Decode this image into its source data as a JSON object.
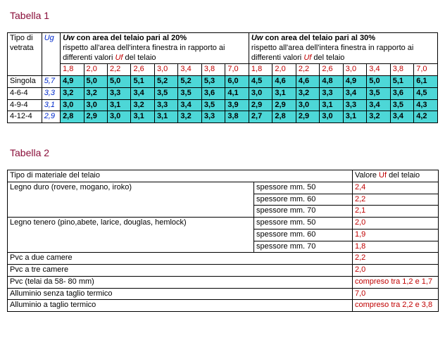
{
  "tabella1": {
    "caption": "Tabella 1",
    "h_type": "Tipo di vetrata",
    "h_ug": "Ug",
    "h_uw20_a": "Uw",
    "h_uw20_b": " con area del telaio pari al 20%",
    "h_uw20_c": "rispetto all'area dell'intera finestra in rapporto ai differenti valori ",
    "h_uw20_d": "Uf",
    "h_uw20_e": " del telaio",
    "h_uw30_a": "Uw",
    "h_uw30_b": " con area del telaio pari al 30%",
    "h_uw30_c": "rispetto all'area dell'intera finestra in rapporto ai differenti valori ",
    "h_uw30_d": "Uf",
    "h_uw30_e": " del telaio",
    "uf20": [
      "1,8",
      "2,0",
      "2,2",
      "2,6",
      "3,0",
      "3,4",
      "3,8",
      "7,0"
    ],
    "uf30": [
      "1,8",
      "2,0",
      "2,2",
      "2,6",
      "3,0",
      "3,4",
      "3,8",
      "7,0"
    ],
    "rows": [
      {
        "type": "Singola",
        "ug": "5,7",
        "v20": [
          "4,9",
          "5,0",
          "5,0",
          "5,1",
          "5,2",
          "5,2",
          "5,3",
          "6,0"
        ],
        "v30": [
          "4,5",
          "4,6",
          "4,6",
          "4,8",
          "4,9",
          "5,0",
          "5,1",
          "6,1"
        ]
      },
      {
        "type": "4-6-4",
        "ug": "3,3",
        "v20": [
          "3,2",
          "3,2",
          "3,3",
          "3,4",
          "3,5",
          "3,5",
          "3,6",
          "4,1"
        ],
        "v30": [
          "3,0",
          "3,1",
          "3,2",
          "3,3",
          "3,4",
          "3,5",
          "3,6",
          "4,5"
        ]
      },
      {
        "type": "4-9-4",
        "ug": "3,1",
        "v20": [
          "3,0",
          "3,0",
          "3,1",
          "3,2",
          "3,3",
          "3,4",
          "3,5",
          "3,9"
        ],
        "v30": [
          "2,9",
          "2,9",
          "3,0",
          "3,1",
          "3,3",
          "3,4",
          "3,5",
          "4,3"
        ]
      },
      {
        "type": "4-12-4",
        "ug": "2,9",
        "v20": [
          "2,8",
          "2,9",
          "3,0",
          "3,1",
          "3,1",
          "3,2",
          "3,3",
          "3,8"
        ],
        "v30": [
          "2,7",
          "2,8",
          "2,9",
          "3,0",
          "3,1",
          "3,2",
          "3,4",
          "4,2"
        ]
      }
    ]
  },
  "tabella2": {
    "caption": "Tabella 2",
    "h_mat": "Tipo di materiale del telaio",
    "h_val_a": "Valore ",
    "h_val_b": "Uf",
    "h_val_c": " del telaio",
    "rows": [
      {
        "mat": "Legno duro (rovere, mogano, iroko)",
        "sp": "spessore mm. 50",
        "val": "2,4",
        "span": 3
      },
      {
        "sp": "spessore mm. 60",
        "val": "2,2"
      },
      {
        "sp": "spessore mm. 70",
        "val": "2,1"
      },
      {
        "mat": "Legno tenero (pino,abete, larice, douglas, hemlock)",
        "sp": "spessore mm. 50",
        "val": "2,0",
        "span": 3
      },
      {
        "sp": "spessore mm. 60",
        "val": "1,9"
      },
      {
        "sp": "spessore mm. 70",
        "val": "1,8"
      },
      {
        "mat": "Pvc a due camere",
        "sp": "",
        "val": "2,2",
        "span": 1,
        "merge": true
      },
      {
        "mat": "Pvc a tre camere",
        "sp": "",
        "val": "2,0",
        "span": 1,
        "merge": true
      },
      {
        "mat": "Pvc (telai da 58- 80 mm)",
        "sp": "",
        "val": "compreso tra 1,2 e 1,7",
        "span": 1,
        "merge": true
      },
      {
        "mat": "Alluminio senza taglio termico",
        "sp": "",
        "val": "7,0",
        "span": 1,
        "merge": true
      },
      {
        "mat": "Alluminio a taglio termico",
        "sp": "",
        "val": "compreso tra 2,2 e 3,8",
        "span": 1,
        "merge": true
      }
    ]
  }
}
